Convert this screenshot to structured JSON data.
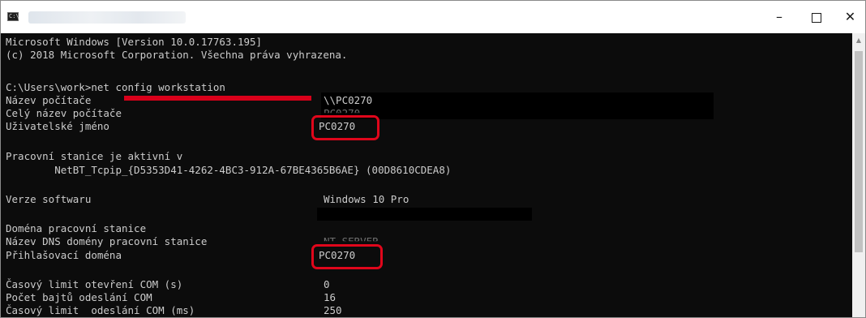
{
  "window": {
    "icon_text": "C:\\",
    "minimize": "–",
    "close": "✕"
  },
  "console": {
    "l1": "Microsoft Windows [Version 10.0.17763.195]",
    "l2": "(c) 2018 Microsoft Corporation. Všechna práva vyhrazena.",
    "l3": "C:\\Users\\work>net config workstation",
    "computer_name_label": "Název počítače",
    "computer_name_value": "\\\\PC0270",
    "full_name_label": "Celý název počítače",
    "full_name_value": "PC0270",
    "user_name_label": "Uživatelské jméno",
    "user_name_value": "PC0270",
    "workstation_active_label": "Pracovní stanice je aktivní v",
    "workstation_active_value": "        NetBT_Tcpip_{D5353D41-4262-4BC3-912A-67BE4365B6AE} (00D8610CDEA8)",
    "software_label": "Verze softwaru",
    "software_value": "Windows 10 Pro",
    "domain_label": "Doména pracovní stanice",
    "dns_label": "Název DNS domény pracovní stanice",
    "dns_value": "NT-SERVER",
    "logon_label": "Přihlašovací doména",
    "logon_value": "PC0270",
    "com_open_label": "Časový limit otevření COM (s)",
    "com_open_value": "0",
    "com_bytes_label": "Počet bajtů odeslání COM",
    "com_bytes_value": "16",
    "com_send_label": "Časový limit  odeslání COM (ms)",
    "com_send_value": "250"
  },
  "colors": {
    "console_bg": "#0c0c0c",
    "console_text": "#cccccc",
    "highlight": "#e0061b"
  }
}
